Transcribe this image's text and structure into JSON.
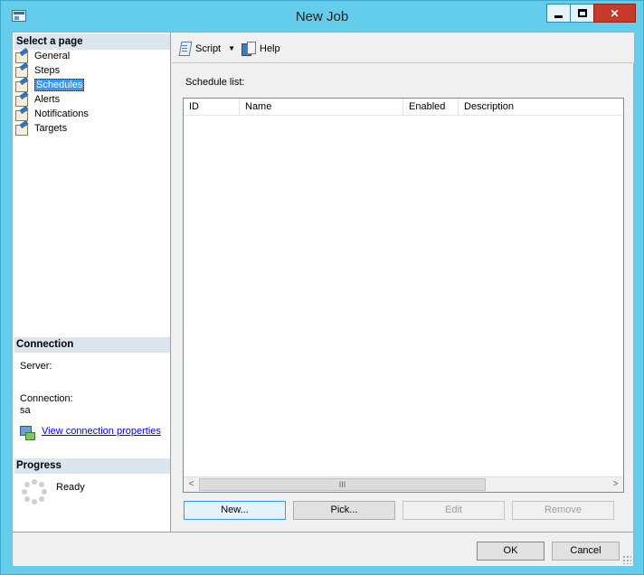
{
  "window": {
    "title": "New Job"
  },
  "left": {
    "select_page_header": "Select a page",
    "pages": [
      {
        "label": "General"
      },
      {
        "label": "Steps"
      },
      {
        "label": "Schedules"
      },
      {
        "label": "Alerts"
      },
      {
        "label": "Notifications"
      },
      {
        "label": "Targets"
      }
    ],
    "selected_page": "Schedules",
    "connection_header": "Connection",
    "server_label": "Server:",
    "connection_label": "Connection:",
    "connection_value": "sa",
    "view_connection_link": "View connection properties",
    "progress_header": "Progress",
    "progress_status": "Ready"
  },
  "toolbar": {
    "script_label": "Script",
    "help_label": "Help"
  },
  "main": {
    "schedule_list_label": "Schedule list:",
    "columns": [
      "ID",
      "Name",
      "Enabled",
      "Description"
    ],
    "rows": [],
    "scroll_thumb_glyph": "III"
  },
  "buttons": {
    "new": "New...",
    "pick": "Pick...",
    "edit": "Edit",
    "remove": "Remove",
    "ok": "OK",
    "cancel": "Cancel"
  },
  "icons": [
    "app-icon",
    "minimize-icon",
    "maximize-icon",
    "close-icon",
    "page-icon",
    "script-icon",
    "help-icon",
    "connection-properties-icon",
    "progress-spinner-icon"
  ]
}
